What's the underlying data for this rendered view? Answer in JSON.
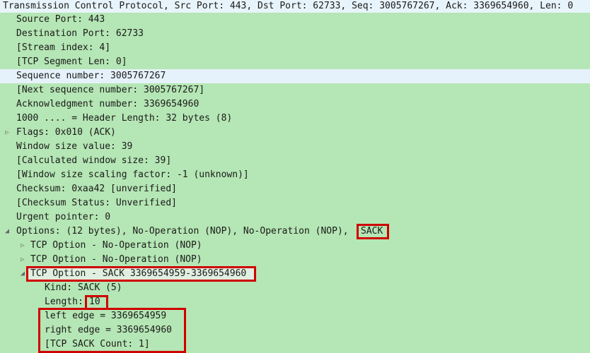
{
  "header": "Transmission Control Protocol, Src Port: 443, Dst Port: 62733, Seq: 3005767267, Ack: 3369654960, Len: 0",
  "fields": {
    "source_port": "Source Port: 443",
    "destination_port": "Destination Port: 62733",
    "stream_index": "[Stream index: 4]",
    "segment_len": "[TCP Segment Len: 0]",
    "sequence_number": "Sequence number: 3005767267",
    "next_sequence_number": "[Next sequence number: 3005767267]",
    "ack_number": "Acknowledgment number: 3369654960",
    "header_length": "1000 .... = Header Length: 32 bytes (8)",
    "flags": "Flags: 0x010 (ACK)",
    "window_size_value": "Window size value: 39",
    "calculated_window_size": "[Calculated window size: 39]",
    "window_scaling_factor": "[Window size scaling factor: -1 (unknown)]",
    "checksum": "Checksum: 0xaa42 [unverified]",
    "checksum_status": "[Checksum Status: Unverified]",
    "urgent_pointer": "Urgent pointer: 0",
    "options_prefix": "Options: (12 bytes), No-Operation (NOP), No-Operation (NOP),",
    "options_sack": "SACK"
  },
  "options": {
    "nop1": "TCP Option - No-Operation (NOP)",
    "nop2": "TCP Option - No-Operation (NOP)",
    "sack": "TCP Option - SACK 3369654959-3369654960",
    "kind": "Kind: SACK (5)",
    "length_prefix": "Length:",
    "length_value": "10",
    "left_edge": "left edge = 3369654959",
    "right_edge": "right edge = 3369654960",
    "sack_count": "[TCP SACK Count: 1]"
  },
  "icons": {
    "collapsed": "triangle-right-icon",
    "expanded": "triangle-down-icon"
  },
  "colors": {
    "background": "#b5e6b5",
    "header_bg": "#e8f4fb",
    "selected_bg": "#e6f2fb",
    "highlight_border": "#d00000"
  }
}
